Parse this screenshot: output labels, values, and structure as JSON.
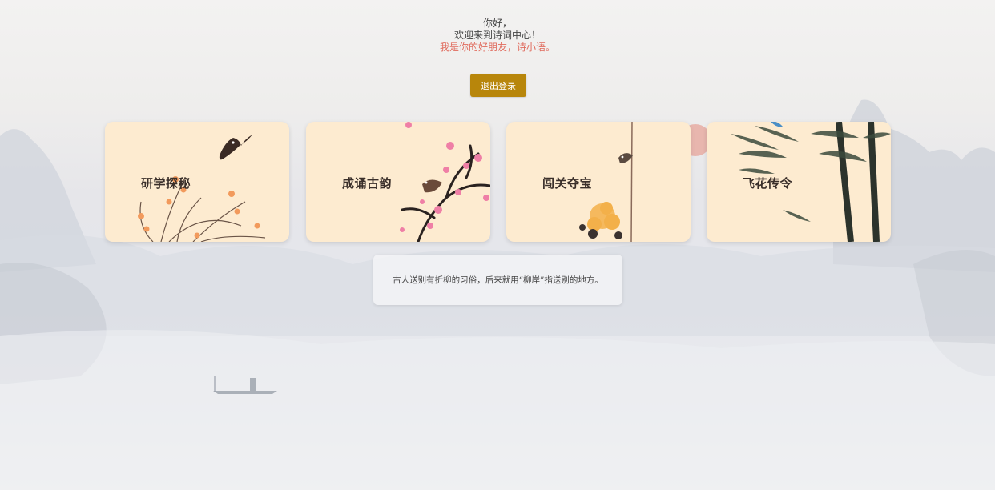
{
  "greeting": {
    "line1": "你好，",
    "line2": "欢迎来到诗词中心！",
    "line3": "我是你的好朋友，诗小语。"
  },
  "logout_label": "退出登录",
  "cards": [
    {
      "label": "研学探秘",
      "icon": "bird-orchid-icon"
    },
    {
      "label": "成诵古韵",
      "icon": "plum-blossom-icon"
    },
    {
      "label": "闯关夺宝",
      "icon": "chrysanthemum-icon"
    },
    {
      "label": "飞花传令",
      "icon": "bamboo-icon"
    }
  ],
  "tip": "古人送别有折柳的习俗，后来就用“柳岸”指送别的地方。",
  "colors": {
    "accent_button": "#b8860b",
    "accent_text": "#e06b5d",
    "card_bg": "#fdebd0"
  }
}
